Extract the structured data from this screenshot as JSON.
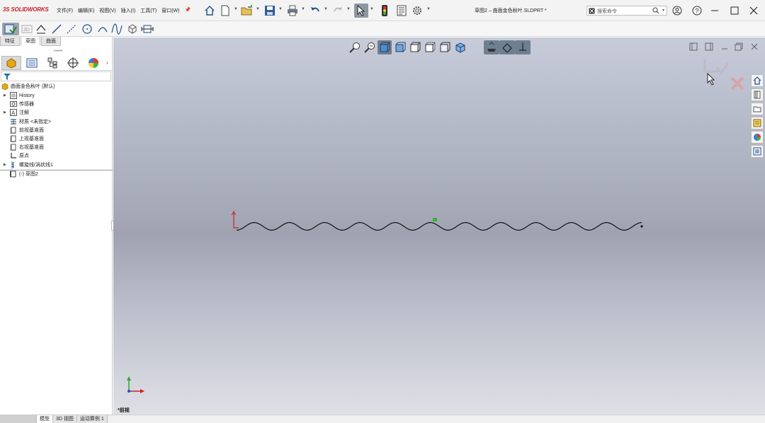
{
  "app": {
    "logo_ds": "3S",
    "logo_text": "SOLIDWORKS"
  },
  "menu": [
    "文件(F)",
    "编辑(E)",
    "视图(V)",
    "插入(I)",
    "工具(T)",
    "窗口(W)"
  ],
  "document_title": "草图2 – 曲面金色秋叶.SLDPRT *",
  "search": {
    "placeholder": "搜索命令"
  },
  "panel_tabs": [
    "特征",
    "草图",
    "曲面"
  ],
  "tree": {
    "root": "曲面金色秋叶 (默认)",
    "items": [
      {
        "label": "History",
        "expandable": true,
        "icon": "history-icon"
      },
      {
        "label": "传感器",
        "expandable": false,
        "icon": "sensor-icon"
      },
      {
        "label": "注解",
        "expandable": true,
        "icon": "annotation-icon"
      },
      {
        "label": "材质 <未指定>",
        "expandable": false,
        "icon": "material-icon"
      },
      {
        "label": "前视基准面",
        "expandable": false,
        "icon": "plane-icon"
      },
      {
        "label": "上视基准面",
        "expandable": false,
        "icon": "plane-icon"
      },
      {
        "label": "右视基准面",
        "expandable": false,
        "icon": "plane-icon"
      },
      {
        "label": "原点",
        "expandable": false,
        "icon": "origin-icon"
      },
      {
        "label": "螺旋线/涡状线1",
        "expandable": true,
        "icon": "helix-icon"
      }
    ],
    "active_sketch": "(-) 草图2"
  },
  "viewport": {
    "view_name": "*前视"
  },
  "bottom_tabs": [
    "模型",
    "3D 视图",
    "运动算例 1"
  ],
  "colors": {
    "accent": "#c8202f",
    "selected": "#6f7f92",
    "viewport_top": "#c8ccd9",
    "viewport_mid": "#9fa2b1"
  }
}
